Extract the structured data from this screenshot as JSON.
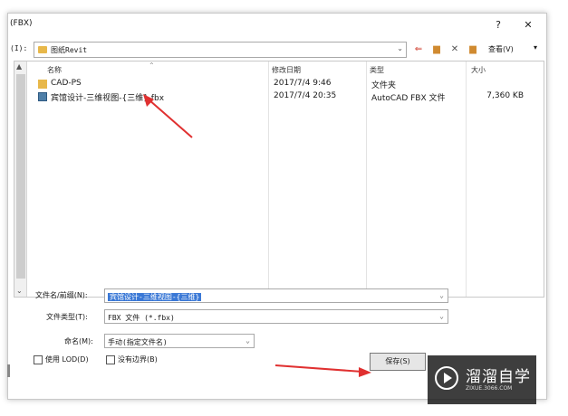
{
  "window": {
    "title": "(FBX)",
    "help_label": "?",
    "close_label": "✕"
  },
  "toolbar": {
    "drive_label": "(I):",
    "lookin_value": "图纸Revit",
    "view_label": "查看(V)"
  },
  "file_list": {
    "columns": [
      "名称",
      "修改日期",
      "类型",
      "大小"
    ],
    "rows": [
      {
        "name": "CAD-PS",
        "date": "2017/7/4 9:46",
        "type": "文件夹",
        "size": "",
        "icon": "folder-icon"
      },
      {
        "name": "宾馆设计-三维视图-{三维}.fbx",
        "date": "2017/7/4 20:35",
        "type": "AutoCAD FBX 文件",
        "size": "7,360 KB",
        "icon": "fbx-file-icon"
      }
    ]
  },
  "form": {
    "filename_label": "文件名/前缀(N):",
    "filename_value": "宾馆设计-三维视图-{三维}",
    "filetype_label": "文件类型(T):",
    "filetype_value": "FBX 文件  (*.fbx)",
    "naming_label": "命名(M):",
    "naming_value": "手动(指定文件名)",
    "use_lod_label": "使用 LOD(D)",
    "no_border_label": "没有边界(B)",
    "save_label": "保存(S)"
  },
  "watermark": {
    "brand": "溜溜自学",
    "url": "ZIXUE.3066.COM"
  },
  "colors": {
    "accent_selection": "#3a78d6",
    "annotation_arrow": "#e03030",
    "folder": "#e8b84a"
  }
}
